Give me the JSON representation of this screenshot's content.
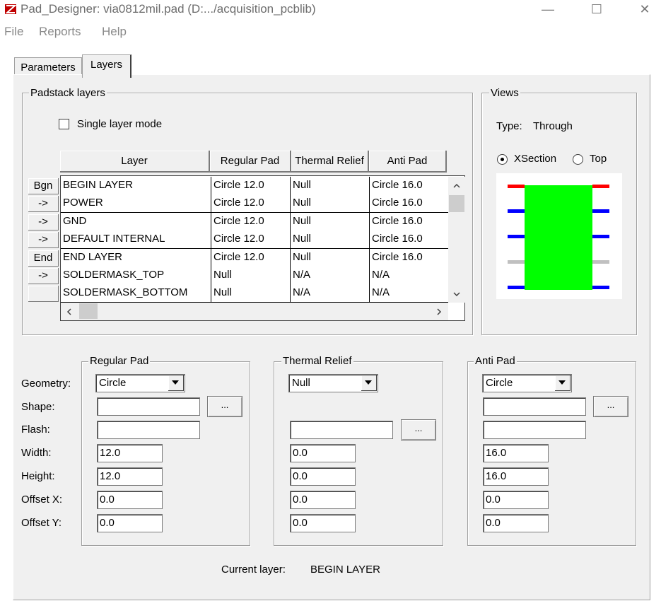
{
  "window": {
    "title": "Pad_Designer: via0812mil.pad (D:.../acquisition_pcblib)",
    "minimize": "—",
    "maximize": "☐",
    "close": "✕"
  },
  "menu": [
    "File",
    "Reports",
    "Help"
  ],
  "tabs": [
    {
      "label": "Parameters",
      "active": false
    },
    {
      "label": "Layers",
      "active": true
    }
  ],
  "padstack": {
    "group_label": "Padstack layers",
    "single_layer_mode": {
      "label": "Single layer mode",
      "checked": false
    },
    "columns": [
      "Layer",
      "Regular Pad",
      "Thermal Relief",
      "Anti Pad"
    ],
    "rows": [
      {
        "button": "Bgn",
        "layer": "BEGIN LAYER",
        "regular": "Circle 12.0",
        "thermal": "Null",
        "anti": "Circle 16.0"
      },
      {
        "button": "->",
        "layer": "POWER",
        "regular": "Circle 12.0",
        "thermal": "Null",
        "anti": "Circle 16.0"
      },
      {
        "button": "->",
        "layer": "GND",
        "regular": "Circle 12.0",
        "thermal": "Null",
        "anti": "Circle 16.0"
      },
      {
        "button": "->",
        "layer": "DEFAULT INTERNAL",
        "regular": "Circle 12.0",
        "thermal": "Null",
        "anti": "Circle 16.0"
      },
      {
        "button": "End",
        "layer": "END LAYER",
        "regular": "Circle 12.0",
        "thermal": "Null",
        "anti": "Circle 16.0"
      },
      {
        "button": "->",
        "layer": "SOLDERMASK_TOP",
        "regular": "Null",
        "thermal": "N/A",
        "anti": "N/A"
      },
      {
        "button": "",
        "layer": "SOLDERMASK_BOTTOM",
        "regular": "Null",
        "thermal": "N/A",
        "anti": "N/A"
      }
    ]
  },
  "views": {
    "group_label": "Views",
    "type_label": "Type:",
    "type_value": "Through",
    "options": [
      {
        "label": "XSection",
        "selected": true
      },
      {
        "label": "Top",
        "selected": false
      }
    ],
    "colors": {
      "pad": "#00ff00",
      "top": "#ff0000",
      "inner": "#0000ff",
      "mask": "#c0c0c0"
    }
  },
  "field_labels": [
    "Geometry:",
    "Shape:",
    "Flash:",
    "Width:",
    "Height:",
    "Offset X:",
    "Offset Y:"
  ],
  "regular_pad": {
    "group_label": "Regular Pad",
    "geometry": "Circle",
    "shape": "",
    "flash": "",
    "width": "12.0",
    "height": "12.0",
    "offset_x": "0.0",
    "offset_y": "0.0",
    "browse": "..."
  },
  "thermal_relief": {
    "group_label": "Thermal Relief",
    "geometry": "Null",
    "flash": "",
    "width": "0.0",
    "height": "0.0",
    "offset_x": "0.0",
    "offset_y": "0.0",
    "browse": "..."
  },
  "anti_pad": {
    "group_label": "Anti Pad",
    "geometry": "Circle",
    "shape": "",
    "flash": "",
    "width": "16.0",
    "height": "16.0",
    "offset_x": "0.0",
    "offset_y": "0.0",
    "browse": "..."
  },
  "status": {
    "label": "Current layer:",
    "value": "BEGIN LAYER"
  }
}
